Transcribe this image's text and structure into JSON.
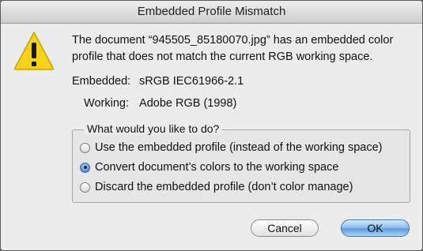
{
  "window": {
    "title": "Embedded Profile Mismatch"
  },
  "message": "The document “945505_85180070.jpg” has an embedded color profile that does not match the current RGB working space.",
  "embedded": {
    "label": "Embedded:",
    "value": "sRGB IEC61966-2.1"
  },
  "working": {
    "label": "Working:",
    "value": "Adobe RGB (1998)"
  },
  "options": {
    "legend": "What would you like to do?",
    "items": [
      {
        "label": "Use the embedded profile (instead of the working space)",
        "selected": false
      },
      {
        "label": "Convert document’s colors to the working space",
        "selected": true
      },
      {
        "label": "Discard the embedded profile (don’t color manage)",
        "selected": false
      }
    ]
  },
  "buttons": {
    "cancel": "Cancel",
    "ok": "OK"
  },
  "icons": {
    "warning": "warning-triangle-icon"
  },
  "colors": {
    "warning_fill": "#f7d21b",
    "ok_button": "#6aa7e6"
  }
}
